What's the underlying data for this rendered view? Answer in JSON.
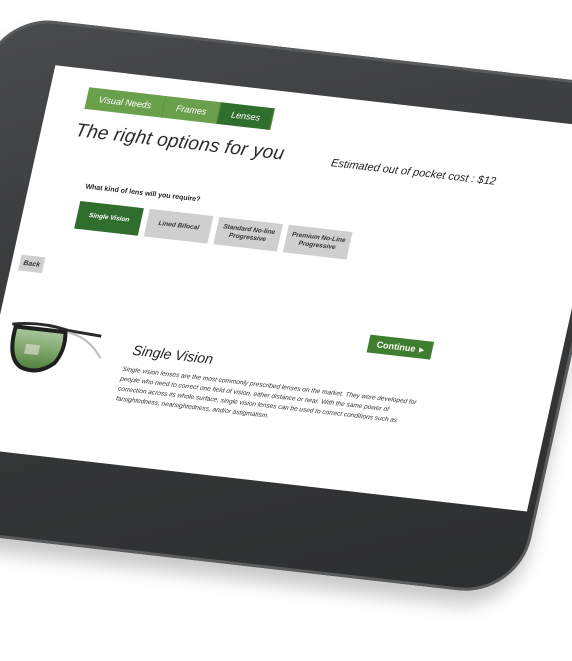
{
  "tabs": [
    {
      "label": "Visual Needs"
    },
    {
      "label": "Frames"
    },
    {
      "label": "Lenses"
    }
  ],
  "page_title": "The right options for you",
  "cost_label": "Estimated out of pocket cost : $12",
  "question": "What kind of lens will you require?",
  "lens_options": [
    {
      "label": "Single Vision"
    },
    {
      "label": "Lined Bifocal"
    },
    {
      "label": "Standard No-line\nProgressive"
    },
    {
      "label": "Premium No-Line\nProgressive"
    }
  ],
  "back_label": "Back",
  "continue_label": "Continue",
  "continue_arrow": "▸",
  "info": {
    "title": "Single Vision",
    "text": "Single vision lenses are the most commonly prescribed lenses on the market. They were developed for people who need to correct one field of vision, either distance or near. With the same power of correction across its whole surface, single vision lenses can be used to correct conditions such as farsightedness, nearsightedness, and/or astigmatism."
  },
  "colors": {
    "tab_green": "#6aa04c",
    "active_green": "#2f6e2c",
    "continue_green": "#3f7d2f",
    "option_grey": "#cfcfcf",
    "bezel": "#3a3b3c"
  },
  "icons": {
    "continue": "chevron-right-icon",
    "image": "eyeglasses-icon"
  }
}
